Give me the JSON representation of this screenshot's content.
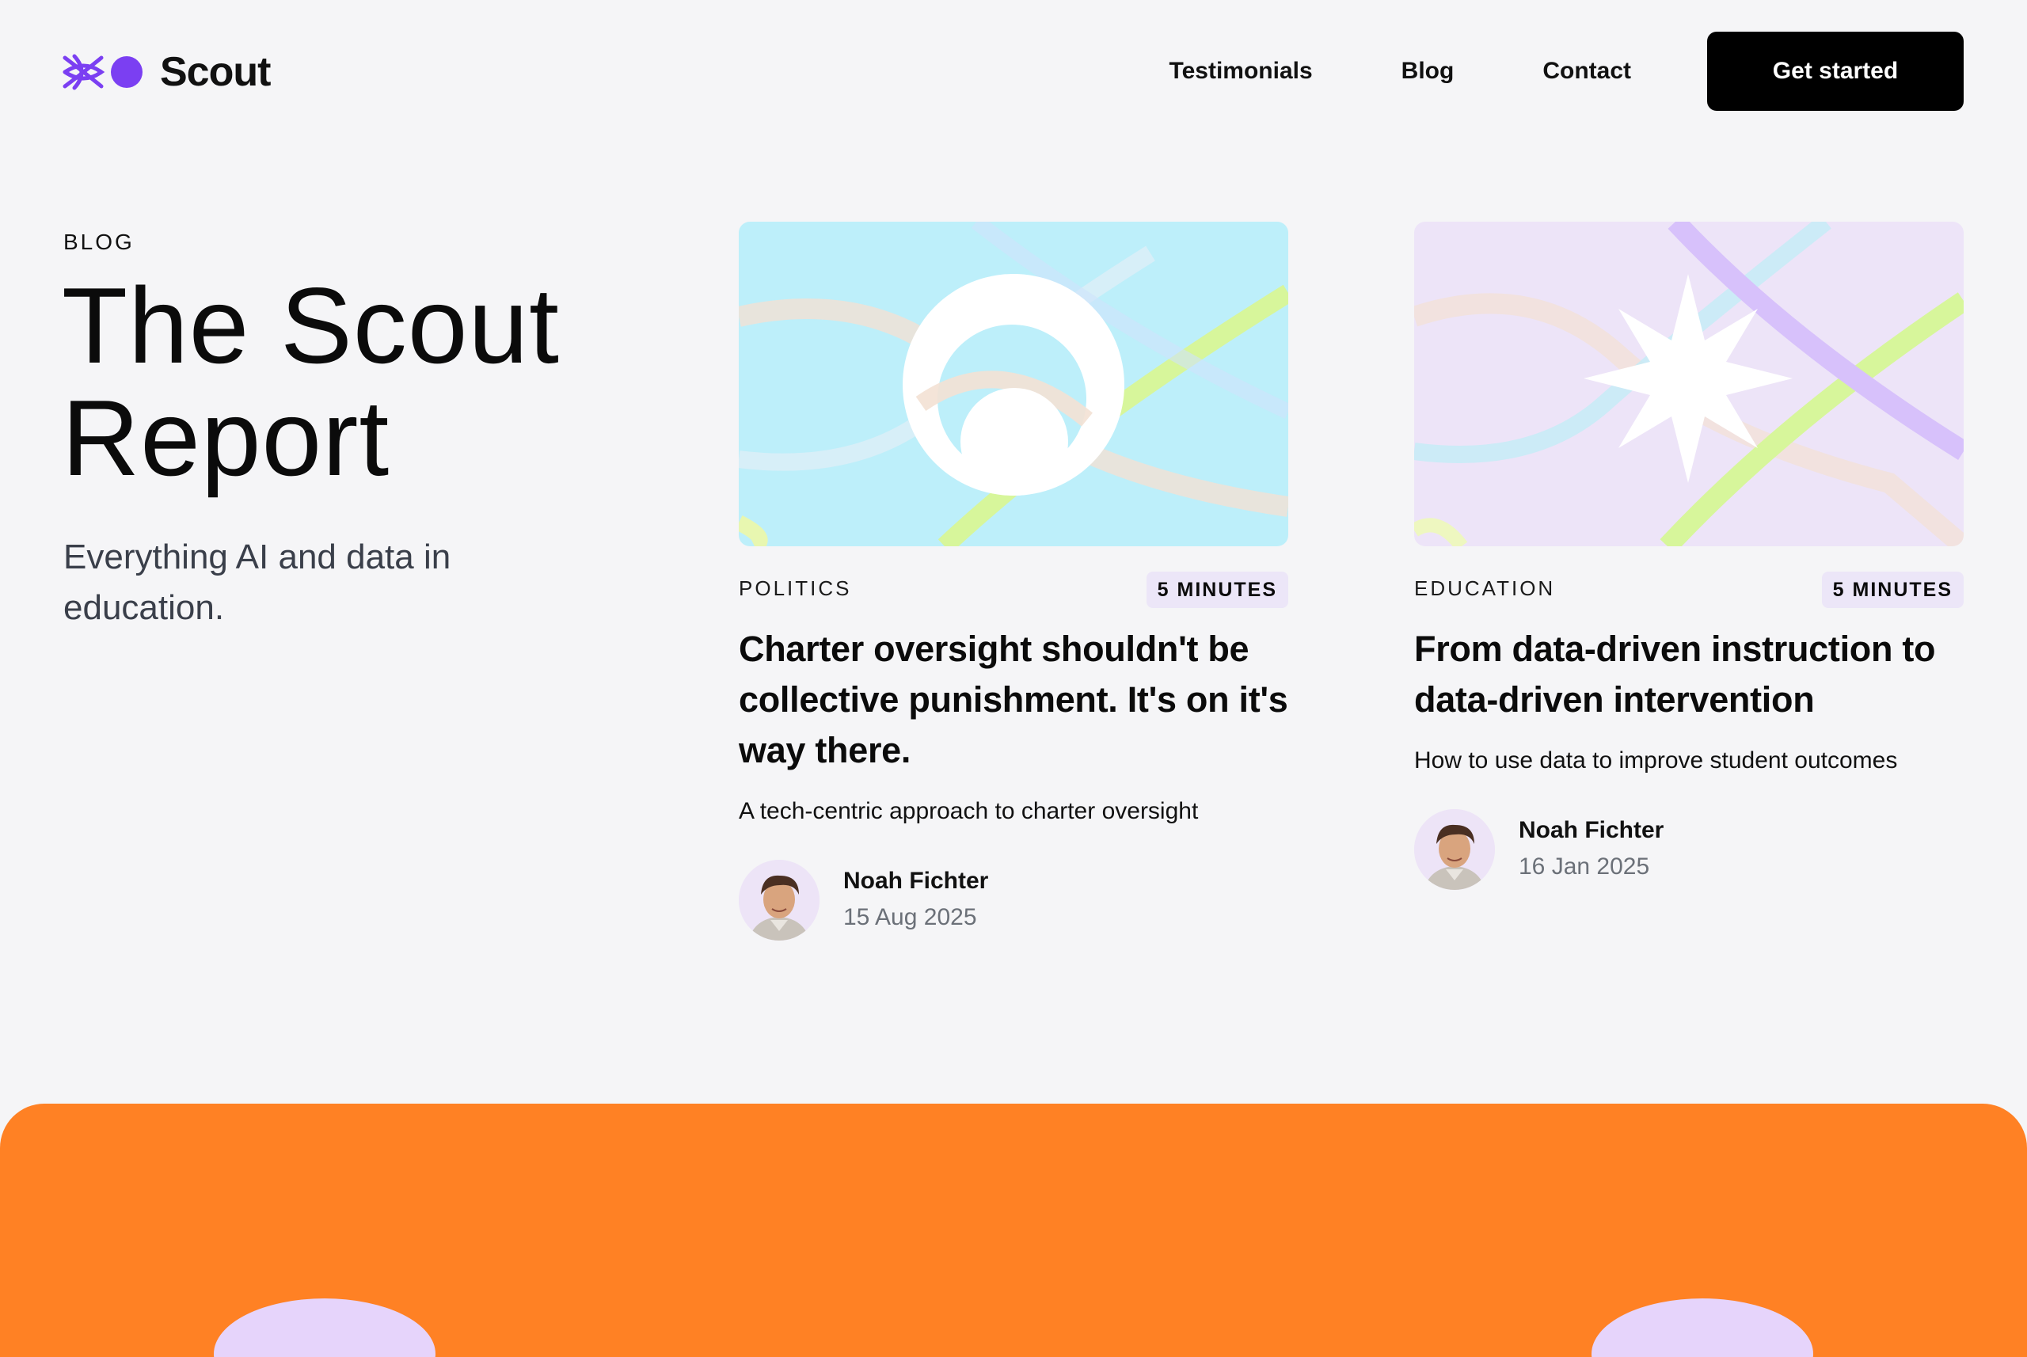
{
  "header": {
    "brand": "Scout",
    "nav": [
      "Testimonials",
      "Blog",
      "Contact"
    ],
    "cta": "Get started"
  },
  "hero": {
    "eyebrow": "BLOG",
    "title_line1": "The Scout",
    "title_line2": "Report",
    "subtitle": "Everything AI and data in education."
  },
  "posts": [
    {
      "category": "POLITICS",
      "read_time": "5 MINUTES",
      "title": "Charter oversight shouldn't be collective punishment. It's on it's way there.",
      "description": "A tech-centric approach to charter oversight",
      "author": "Noah Fichter",
      "date": "15 Aug 2025",
      "thumbnail_icon": "crescent-circle-icon",
      "thumbnail_bg": "#bdeffa"
    },
    {
      "category": "EDUCATION",
      "read_time": "5 MINUTES",
      "title": "From data-driven instruction to data-driven intervention",
      "description": "How to use data to improve student outcomes",
      "author": "Noah Fichter",
      "date": "16 Jan 2025",
      "thumbnail_icon": "star-burst-icon",
      "thumbnail_bg": "#ede4f8"
    }
  ],
  "colors": {
    "brand_purple": "#7b3ff2",
    "accent_orange": "#ff8124",
    "background": "#f5f5f7"
  }
}
